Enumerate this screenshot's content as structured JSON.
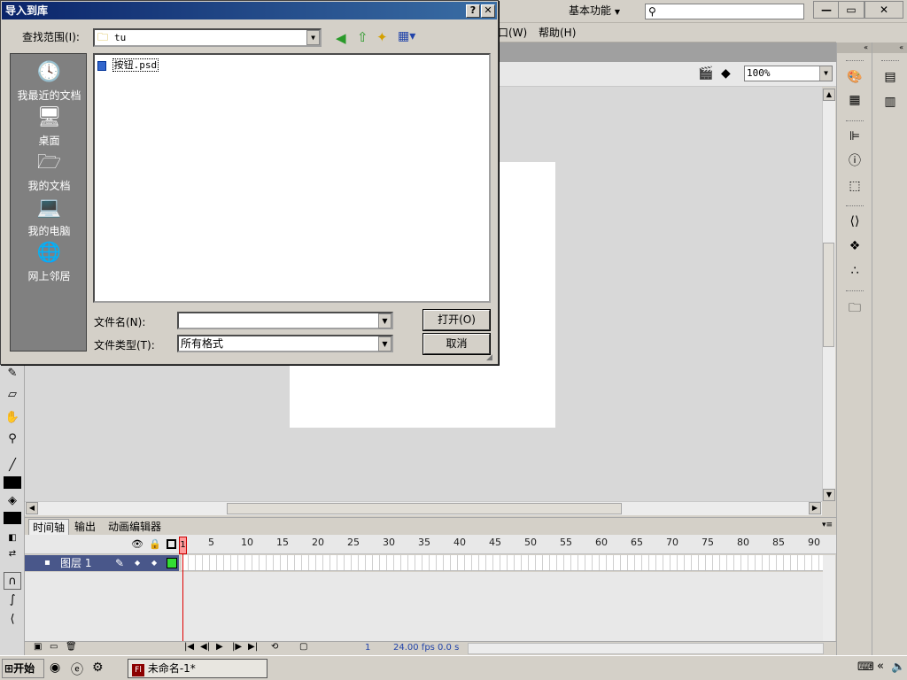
{
  "topbar": {
    "workspace": "基本功能",
    "search_placeholder": "",
    "minimize": "—",
    "restore": "▭",
    "close": "✕"
  },
  "menubar": {
    "items": [
      "口(W)",
      "帮助(H)"
    ]
  },
  "editbar": {
    "zoom": "100%"
  },
  "timeline": {
    "tabs": [
      "时间轴",
      "输出",
      "动画编辑器"
    ],
    "frame_numbers": [
      "1",
      "5",
      "10",
      "15",
      "20",
      "25",
      "30",
      "35",
      "40",
      "45",
      "50",
      "55",
      "60",
      "65",
      "70",
      "75",
      "80",
      "85",
      "90"
    ],
    "layer_name": "图层 1",
    "status_frame": "1",
    "status_fps": "24.00 fps",
    "status_time": "0.0 s"
  },
  "taskbar": {
    "start": "开始",
    "task_label": "未命名-1*"
  },
  "dialog": {
    "title": "导入到库",
    "lookin_label": "查找范围(I):",
    "lookin_value": "tu",
    "places": [
      "我最近的文档",
      "桌面",
      "我的文档",
      "我的电脑",
      "网上邻居"
    ],
    "files": [
      "按钮.psd"
    ],
    "filename_label": "文件名(N):",
    "filename_value": "",
    "filetype_label": "文件类型(T):",
    "filetype_value": "所有格式",
    "open_button": "打开(O)",
    "cancel_button": "取消",
    "help_btn": "?",
    "close_btn": "✕"
  }
}
